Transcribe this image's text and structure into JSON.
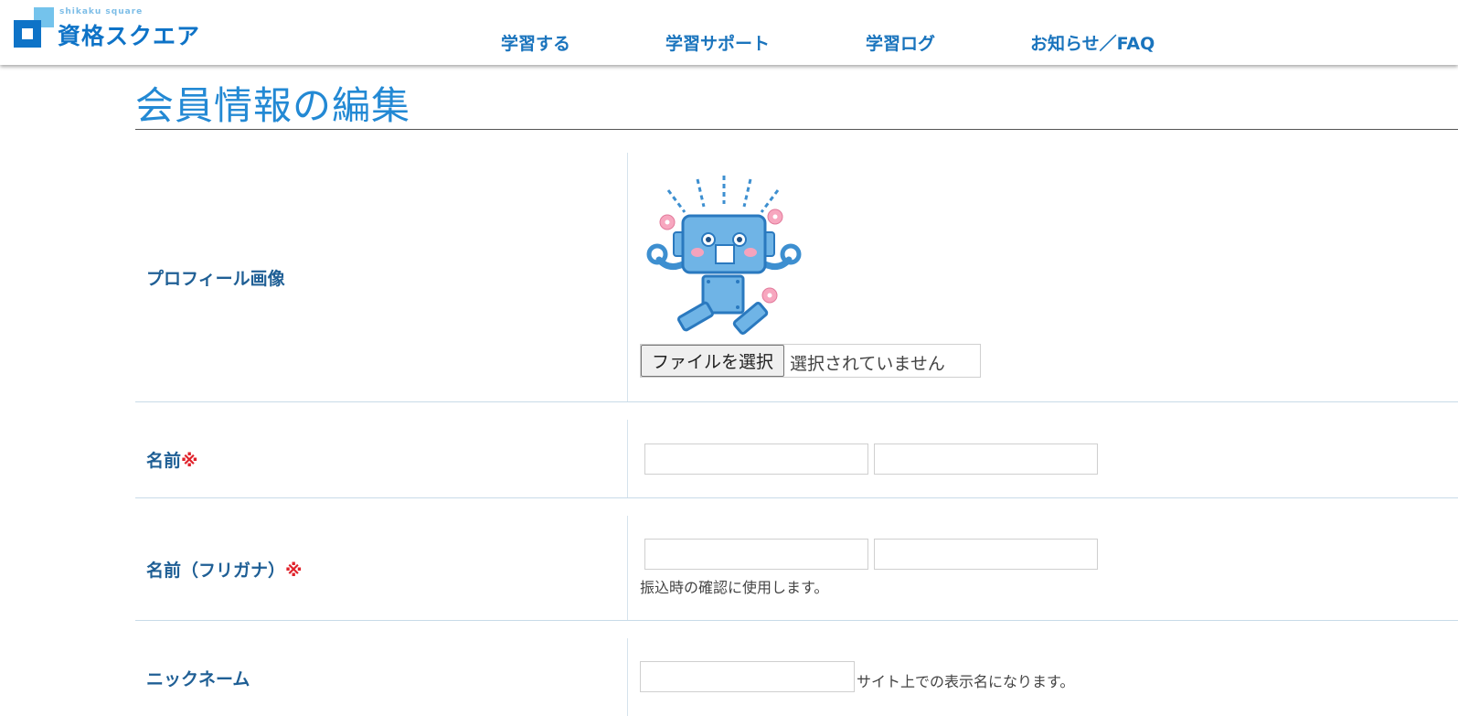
{
  "logo": {
    "subtitle": "shikaku square",
    "title": "資格スクエア"
  },
  "nav": [
    {
      "label": "学習する"
    },
    {
      "label": "学習サポート"
    },
    {
      "label": "学習ログ"
    },
    {
      "label": "お知らせ／FAQ"
    }
  ],
  "page_title": "会員情報の編集",
  "form": {
    "profile_image": {
      "label": "プロフィール画像",
      "file_button": "ファイルを選択",
      "file_status": "選択されていません"
    },
    "name": {
      "label": "名前",
      "required_mark": "※",
      "last_value": "",
      "first_value": ""
    },
    "name_kana": {
      "label": "名前（フリガナ）",
      "required_mark": "※",
      "last_value": "",
      "first_value": "",
      "hint": "振込時の確認に使用します。"
    },
    "nickname": {
      "label": "ニックネーム",
      "value": "",
      "hint": "サイト上での表示名になります。"
    }
  },
  "colors": {
    "brand": "#0e73c7",
    "nav_text": "#1a74bd",
    "title": "#2389d4",
    "label": "#1f5f95",
    "required": "#e0222b"
  }
}
